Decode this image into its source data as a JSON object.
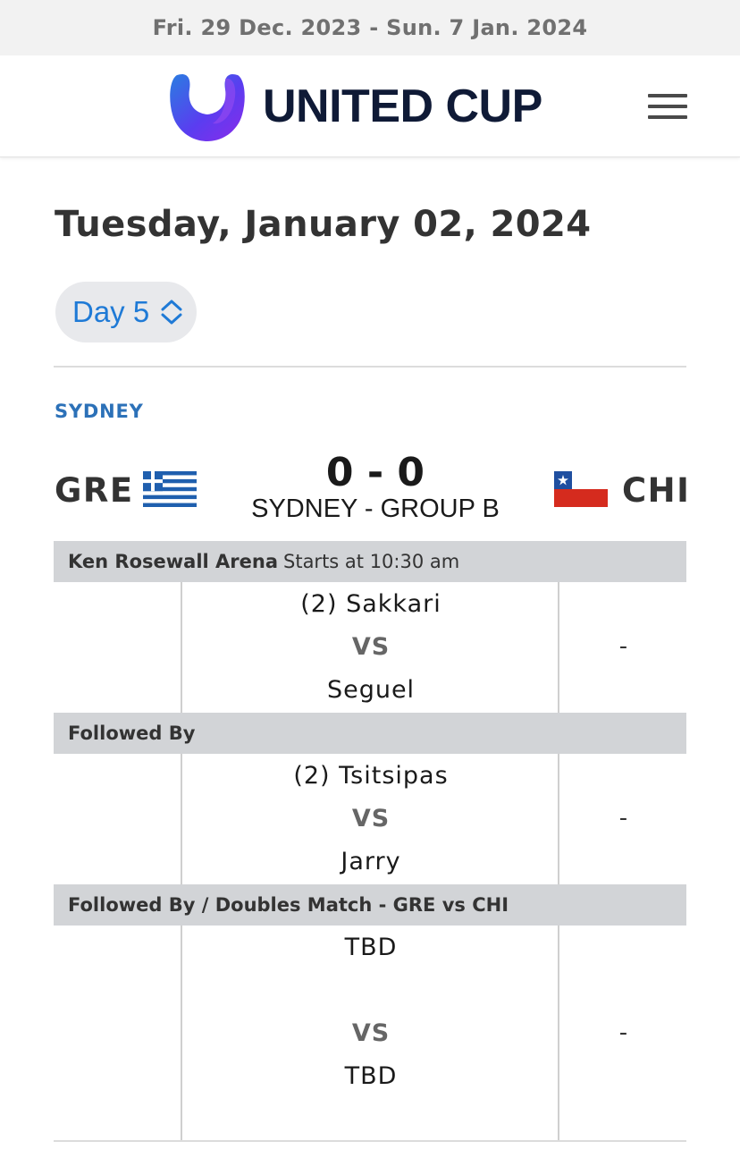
{
  "event_dates": "Fri. 29 Dec. 2023 - Sun. 7 Jan. 2024",
  "brand": {
    "name": "UNITED CUP",
    "logo_icon": "united-cup-u-logo",
    "menu_icon": "hamburger-menu-icon"
  },
  "page_title": "Tuesday, January 02, 2024",
  "day_selector": {
    "label": "Day 5",
    "icon": "chevron-up-down-icon"
  },
  "city": "SYDNEY",
  "tie": {
    "home": {
      "code": "GRE",
      "flag": "greece-flag"
    },
    "away": {
      "code": "CHI",
      "flag": "chile-flag"
    },
    "score": "0 - 0",
    "group": "SYDNEY - GROUP B"
  },
  "schedule": [
    {
      "header_bold": "Ken Rosewall Arena",
      "header_rest": "Starts at 10:30 am",
      "player1": "(2) Sakkari",
      "vs": "VS",
      "player2": "Seguel",
      "result": "-"
    },
    {
      "header_bold": "Followed By",
      "header_rest": "",
      "player1": "(2) Tsitsipas",
      "vs": "VS",
      "player2": "Jarry",
      "result": "-"
    },
    {
      "header_bold": "Followed By / Doubles Match - GRE vs CHI",
      "header_rest": "",
      "player1": "TBD",
      "vs": "VS",
      "player2": "TBD",
      "result": "-"
    }
  ],
  "colors": {
    "brand_navy": "#0f1a36",
    "accent_blue": "#1f7ad6",
    "city_blue": "#2c71b8",
    "band_gray": "#d2d4d7"
  }
}
